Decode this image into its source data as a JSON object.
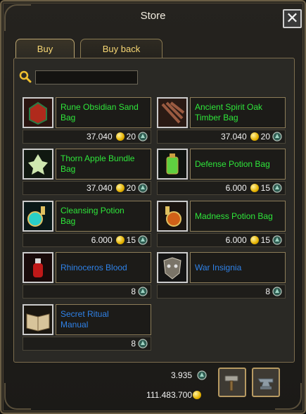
{
  "window": {
    "title": "Store",
    "close_symbol": "✕"
  },
  "tabs": [
    {
      "label": "Buy",
      "active": true
    },
    {
      "label": "Buy back",
      "active": false
    }
  ],
  "search": {
    "value": "",
    "placeholder": ""
  },
  "items": [
    {
      "name_line1": "Rune Obsidian Sand",
      "name_line2": "Bag",
      "color": "green",
      "icon": "obsidian-sand-bag-icon",
      "price": "37.040",
      "coins": "20"
    },
    {
      "name_line1": "Ancient Spirit Oak",
      "name_line2": "Timber Bag",
      "color": "green",
      "icon": "oak-timber-bag-icon",
      "price": "37.040",
      "coins": "20"
    },
    {
      "name_line1": "Thorn Apple Bundle",
      "name_line2": "Bag",
      "color": "green",
      "icon": "thorn-apple-bag-icon",
      "price": "37.040",
      "coins": "20"
    },
    {
      "name_line1": "Defense Potion Bag",
      "name_line2": "",
      "color": "green",
      "icon": "defense-potion-bag-icon",
      "price": "6.000",
      "coins": "15"
    },
    {
      "name_line1": "Cleansing Potion",
      "name_line2": "Bag",
      "color": "green",
      "icon": "cleansing-potion-bag-icon",
      "price": "6.000",
      "coins": "15"
    },
    {
      "name_line1": "Madness Potion Bag",
      "name_line2": "",
      "color": "green",
      "icon": "madness-potion-bag-icon",
      "price": "6.000",
      "coins": "15"
    },
    {
      "name_line1": "Rhinoceros Blood",
      "name_line2": "",
      "color": "blue",
      "icon": "rhinoceros-blood-icon",
      "price": "",
      "coins": "8"
    },
    {
      "name_line1": "War Insignia",
      "name_line2": "",
      "color": "blue",
      "icon": "war-insignia-icon",
      "price": "",
      "coins": "8"
    },
    {
      "name_line1": "Secret Ritual",
      "name_line2": "Manual",
      "color": "blue",
      "icon": "ritual-manual-icon",
      "price": "",
      "coins": "8"
    }
  ],
  "balance": {
    "gems": "3.935",
    "silver": "111.483.700"
  },
  "colors": {
    "item_green": "#2ee63a",
    "item_blue": "#2f82e8",
    "tab_text": "#f7d774",
    "frame": "#8c7c58"
  }
}
